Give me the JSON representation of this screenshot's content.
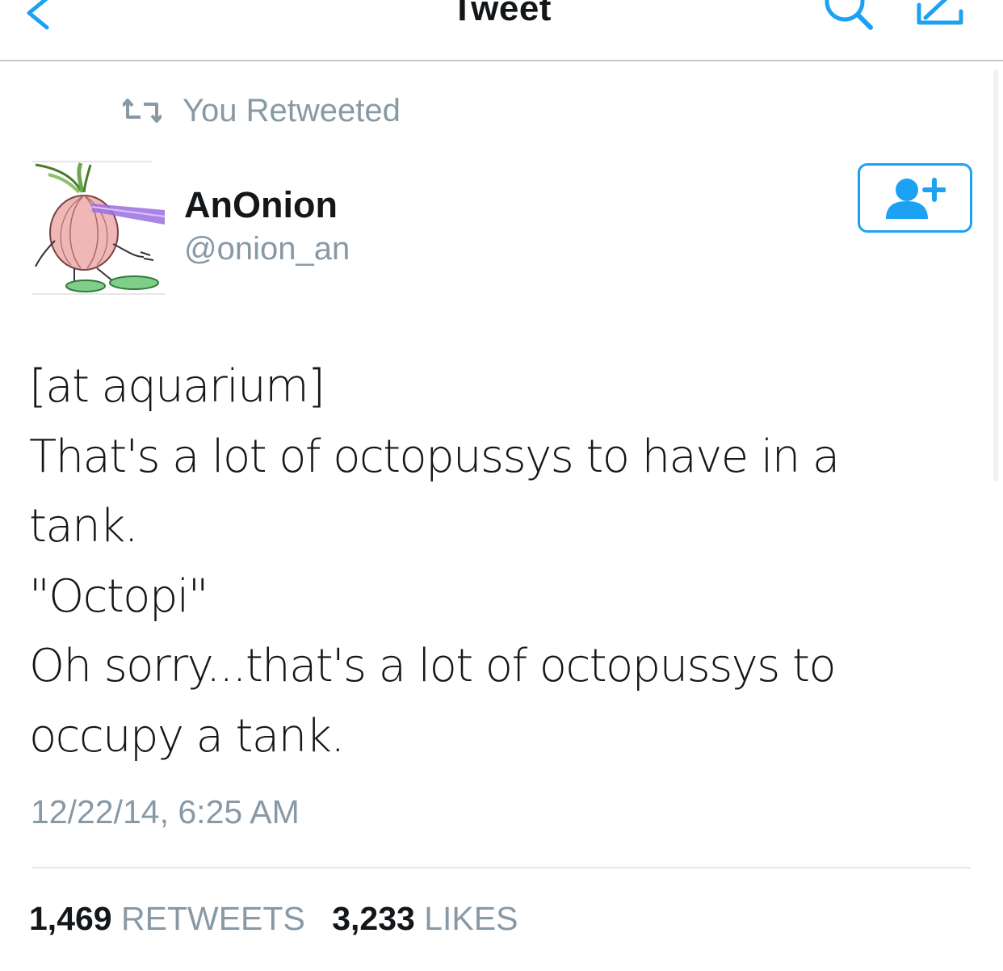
{
  "nav": {
    "title": "Tweet"
  },
  "retweet_context": {
    "label": "You Retweeted"
  },
  "author": {
    "display_name": "AnOnion",
    "handle": "@onion_an"
  },
  "tweet": {
    "lines": [
      "[at aquarium]",
      "That's a lot of octopussys to have in a",
      "tank.",
      "\"Octopi\"",
      "Oh sorry...that's a lot of octopussys to",
      "occupy a tank."
    ],
    "timestamp": "12/22/14, 6:25 AM"
  },
  "stats": {
    "retweets_count": "1,469",
    "retweets_label": "RETWEETS",
    "likes_count": "3,233",
    "likes_label": "LIKES"
  },
  "colors": {
    "accent": "#1da1f2",
    "secondary_text": "#8899a6",
    "primary_text": "#14171a",
    "divider": "#e1e8ed"
  },
  "icons": {
    "back": "chevron-left-icon",
    "search": "search-icon",
    "compose": "compose-icon",
    "retweet": "retweet-icon",
    "follow": "add-user-icon"
  }
}
